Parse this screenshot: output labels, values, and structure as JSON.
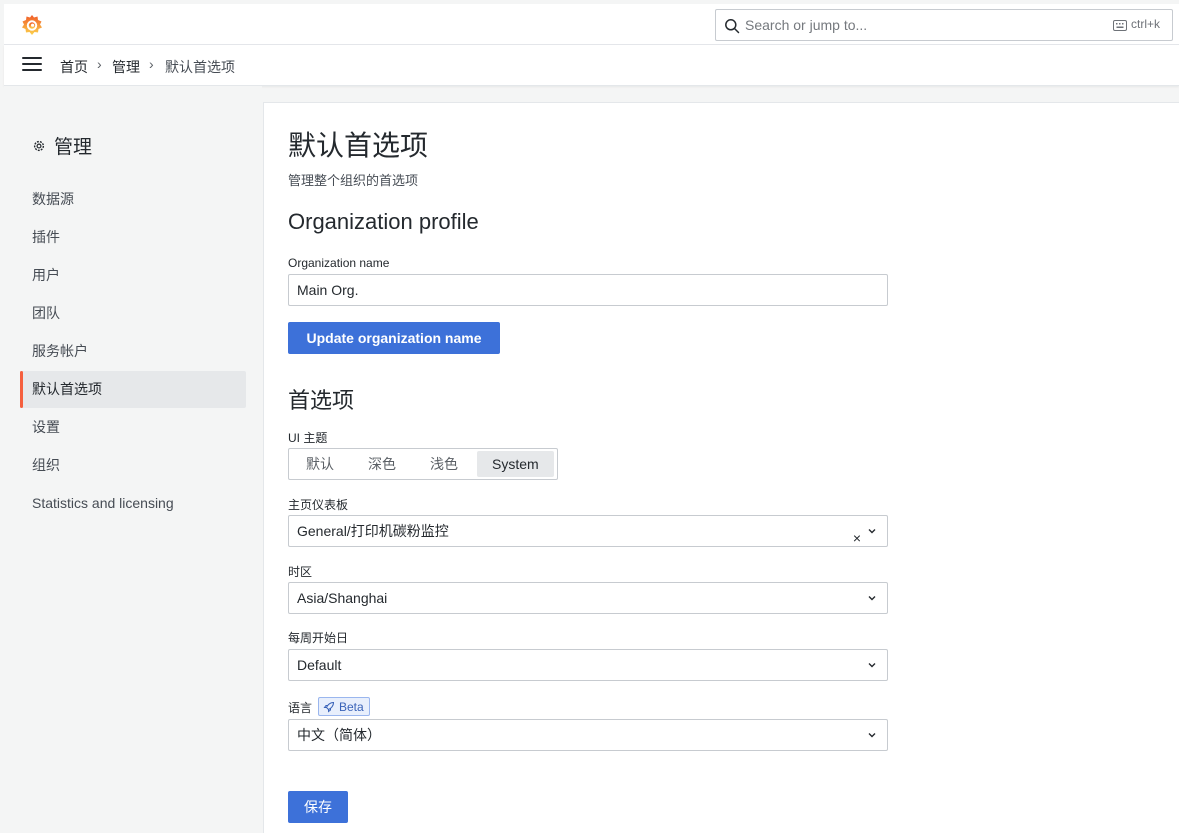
{
  "topbar": {
    "search_placeholder": "Search or jump to...",
    "shortcut": "ctrl+k"
  },
  "breadcrumb": {
    "items": [
      "首页",
      "管理",
      "默认首选项"
    ]
  },
  "sidebar": {
    "title": "管理",
    "items": [
      {
        "label": "数据源"
      },
      {
        "label": "插件"
      },
      {
        "label": "用户"
      },
      {
        "label": "团队"
      },
      {
        "label": "服务帐户"
      },
      {
        "label": "默认首选项",
        "active": true
      },
      {
        "label": "设置"
      },
      {
        "label": "组织"
      },
      {
        "label": "Statistics and licensing"
      }
    ]
  },
  "page": {
    "title": "默认首选项",
    "subtitle": "管理整个组织的首选项"
  },
  "org_profile": {
    "heading": "Organization profile",
    "name_label": "Organization name",
    "name_value": "Main Org.",
    "update_button": "Update organization name"
  },
  "preferences": {
    "heading": "首选项",
    "theme_label": "UI 主题",
    "theme_options": [
      "默认",
      "深色",
      "浅色",
      "System"
    ],
    "theme_selected": "System",
    "home_dashboard_label": "主页仪表板",
    "home_dashboard_value": "General/打印机碳粉监控",
    "timezone_label": "时区",
    "timezone_value": "Asia/Shanghai",
    "week_start_label": "每周开始日",
    "week_start_value": "Default",
    "language_label": "语言",
    "beta_badge": "Beta",
    "language_value": "中文（简体）",
    "save_button": "保存"
  },
  "colors": {
    "primary": "#3d71d9",
    "active_indicator": "#f55f3e"
  }
}
